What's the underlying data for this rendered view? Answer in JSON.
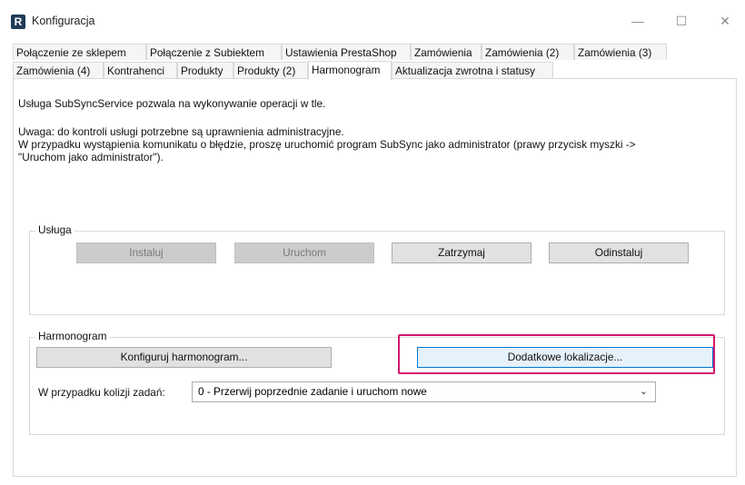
{
  "window": {
    "app_icon_letter": "R",
    "title": "Konfiguracja",
    "minimize": "—",
    "maximize": "☐",
    "close": "✕"
  },
  "tabs_row1": [
    "Połączenie ze sklepem",
    "Połączenie z Subiektem",
    "Ustawienia PrestaShop",
    "Zamówienia",
    "Zamówienia (2)",
    "Zamówienia (3)"
  ],
  "tabs_row2": [
    "Zamówienia (4)",
    "Kontrahenci",
    "Produkty",
    "Produkty (2)",
    "Harmonogram",
    "Aktualizacja zwrotna i statusy"
  ],
  "active_tab": "Harmonogram",
  "info": {
    "line1": "Usługa SubSyncService pozwala na wykonywanie operacji w tle.",
    "line2": "Uwaga: do kontroli usługi potrzebne są uprawnienia administracyjne.",
    "line3": "W przypadku wystąpienia komunikatu o błędzie, proszę uruchomić program SubSync jako administrator (prawy przycisk myszki ->",
    "line4": "\"Uruchom jako administrator\")."
  },
  "service_group": {
    "label": "Usługa",
    "install": "Instaluj",
    "run": "Uruchom",
    "stop": "Zatrzymaj",
    "uninstall": "Odinstaluj"
  },
  "schedule_group": {
    "label": "Harmonogram",
    "configure": "Konfiguruj harmonogram...",
    "extra_locations": "Dodatkowe lokalizacje...",
    "conflict_label": "W przypadku kolizji zadań:",
    "conflict_value": "0 - Przerwij poprzednie zadanie i uruchom nowe"
  },
  "colors": {
    "highlight": "#d0176d",
    "focus_border": "#0078d7"
  }
}
